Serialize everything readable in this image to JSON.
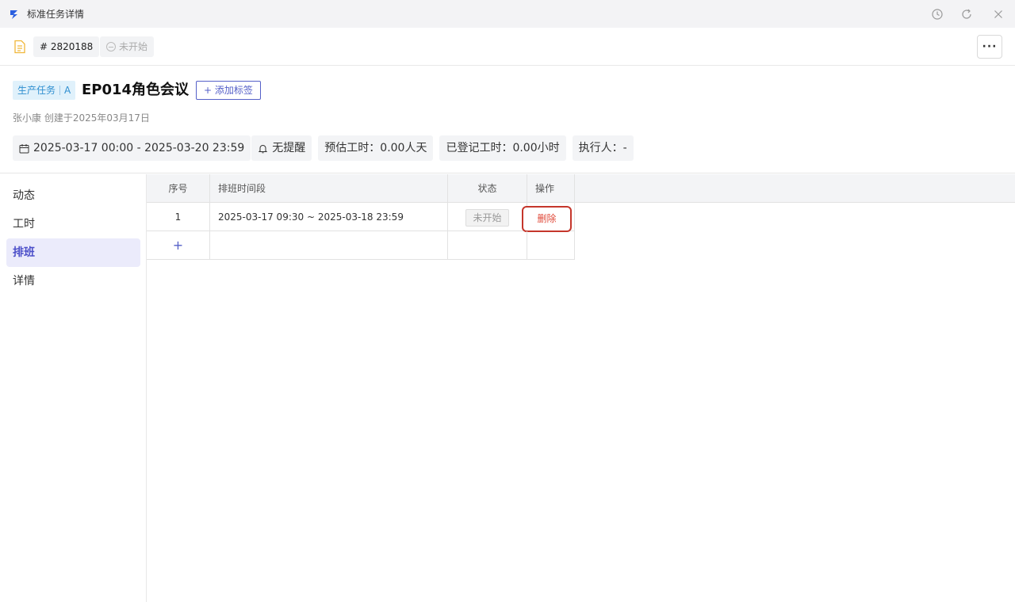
{
  "window": {
    "title": "标准任务详情",
    "controls": [
      "history-icon",
      "refresh-icon",
      "close-icon"
    ]
  },
  "toolbar": {
    "task_id": "# 2820188",
    "status": "未开始",
    "more_label": "···"
  },
  "header": {
    "type_tag": "生产任务",
    "type_level": "A",
    "title": "EP014角色会议",
    "add_tag_label": "+ 添加标签",
    "created_by": "张小康 创建于2025年03月17日",
    "chips": {
      "date_range": "2025-03-17 00:00 - 2025-03-20 23:59",
      "reminder": "无提醒",
      "estimated": "预估工时：0.00人天",
      "logged": "已登记工时：0.00小时",
      "assignee": "执行人：-"
    }
  },
  "sidebar": {
    "items": [
      {
        "label": "动态",
        "active": false
      },
      {
        "label": "工时",
        "active": false
      },
      {
        "label": "排班",
        "active": true
      },
      {
        "label": "详情",
        "active": false
      }
    ]
  },
  "table": {
    "headers": {
      "index": "序号",
      "range": "排班时间段",
      "status": "状态",
      "op": "操作"
    },
    "rows": [
      {
        "index": "1",
        "range": "2025-03-17 09:30 ~ 2025-03-18 23:59",
        "status": "未开始",
        "op": "删除"
      }
    ],
    "add_row_label": "+"
  },
  "colors": {
    "accent": "#4c4fc9",
    "delete": "#e04a3a",
    "tag_bg": "#e0f1fb"
  }
}
